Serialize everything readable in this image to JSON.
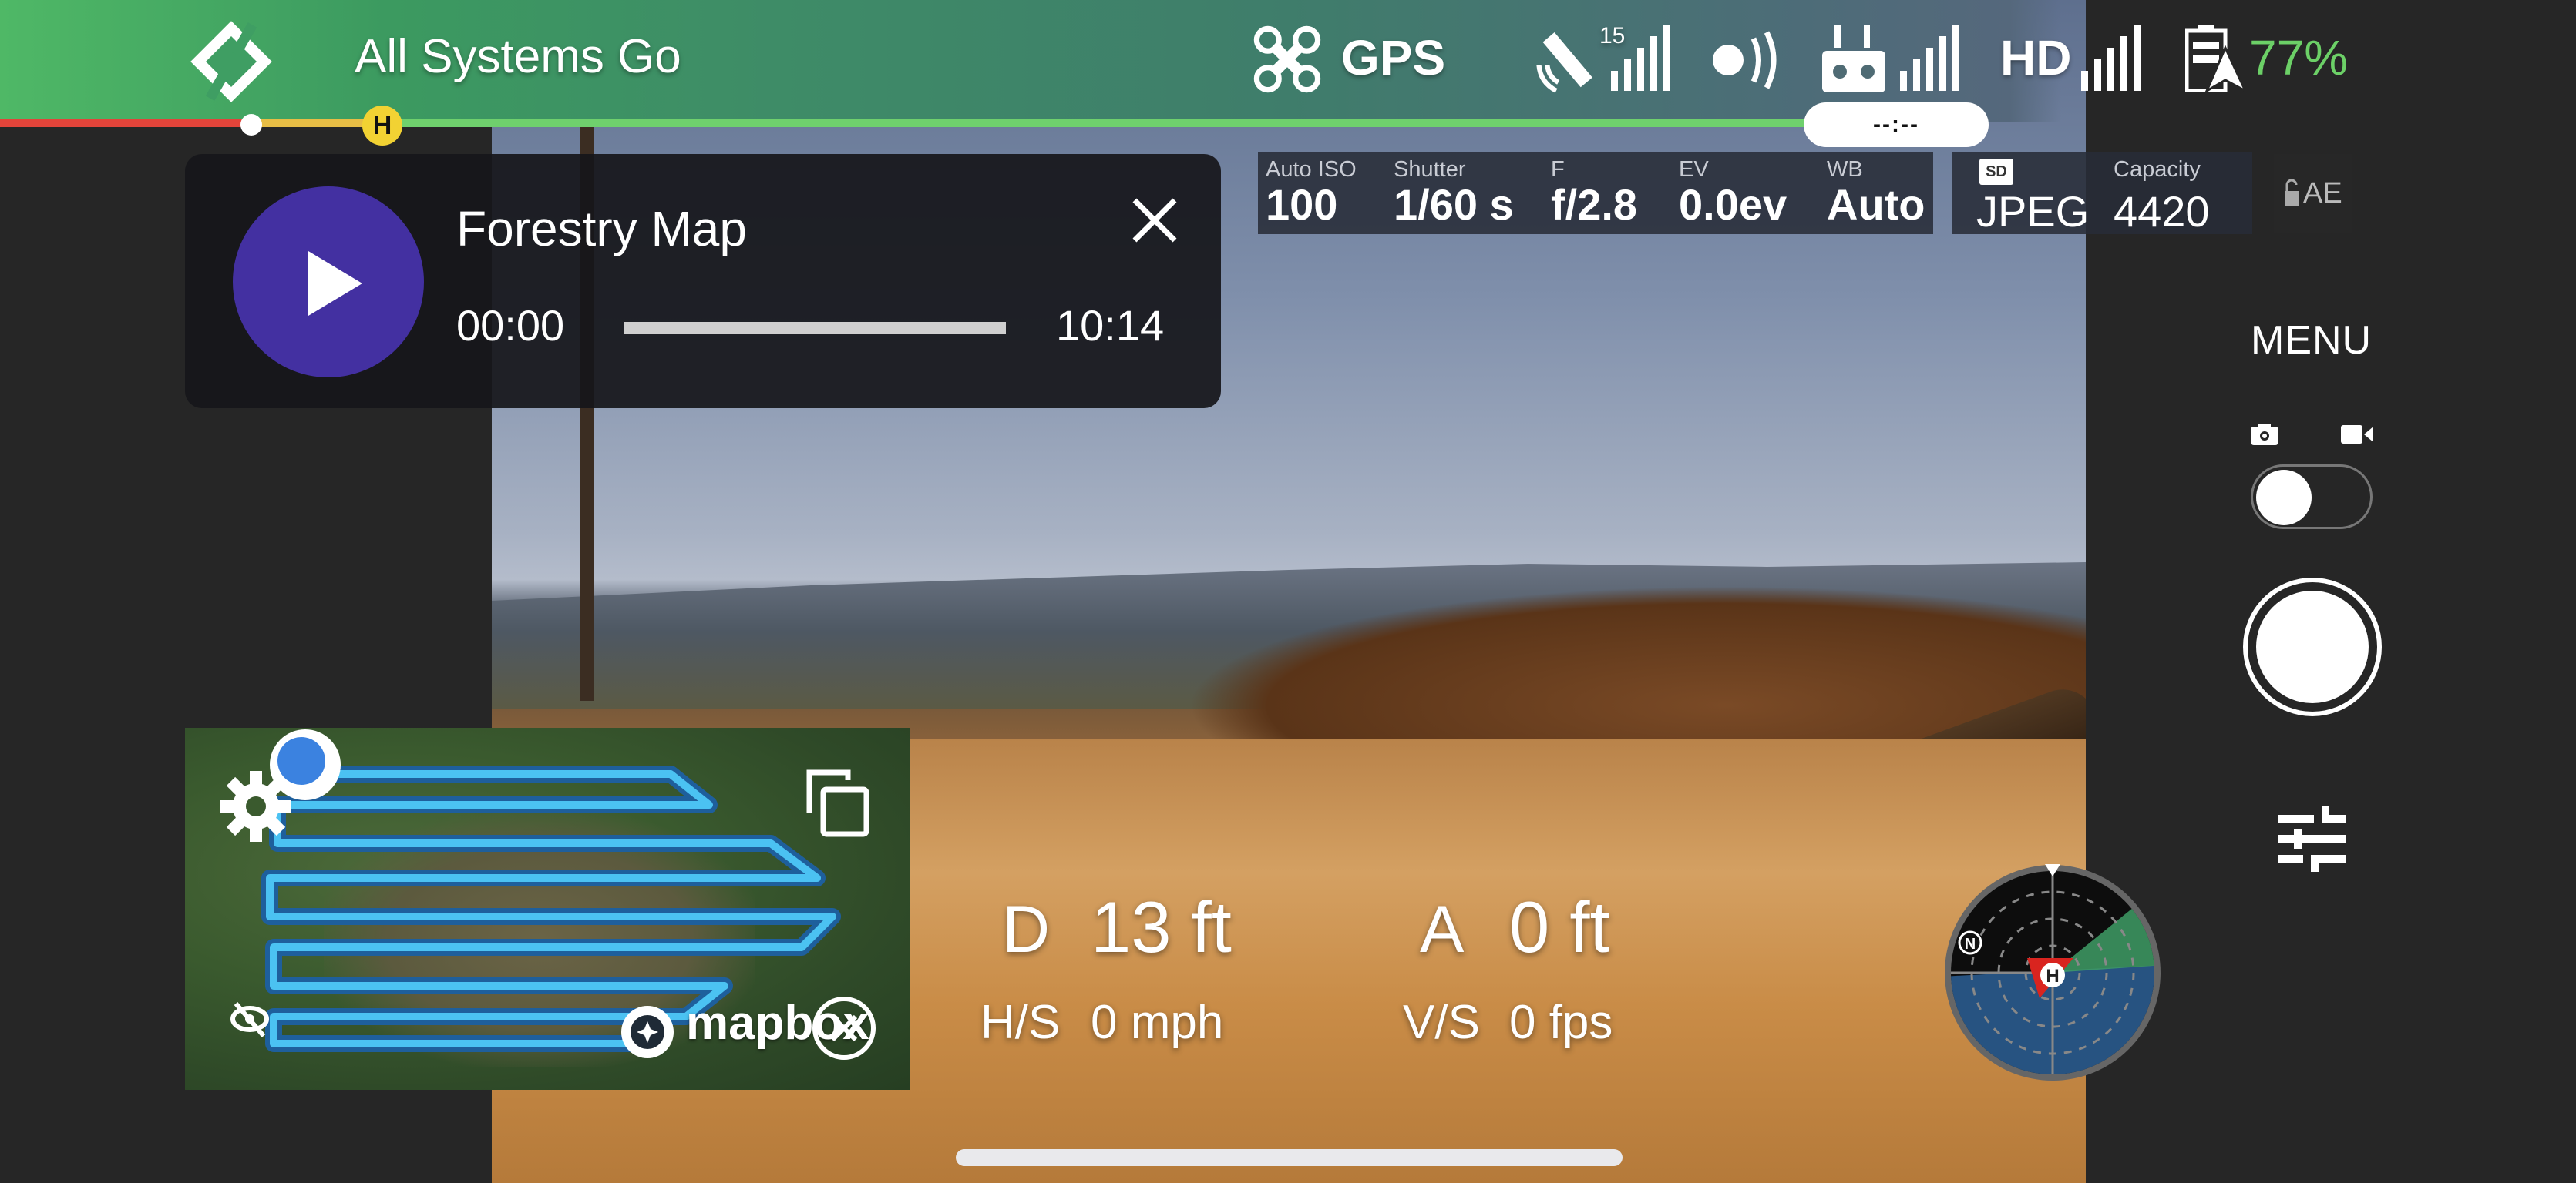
{
  "status": {
    "message": "All Systems Go",
    "flight_mode": "GPS",
    "satellite_count": "15",
    "video_quality": "HD",
    "battery_percent": "77%",
    "battery_color": "#6cd067",
    "flight_timer": "--:--",
    "home_marker": "H",
    "icons": {
      "logo": "app-logo-icon",
      "drone": "drone-icon",
      "satellite": "satellite-icon",
      "rc_signal": "signal-wave-icon",
      "controller": "remote-controller-icon",
      "battery": "battery-icon"
    },
    "progress_colors": {
      "critical": "#e2443a",
      "warning": "#e7bd45",
      "ok": "#6fd06d"
    }
  },
  "media_player": {
    "title": "Forestry Map",
    "current_time": "00:00",
    "total_time": "10:14",
    "progress": 0,
    "accent": "#4330a1"
  },
  "camera": {
    "params": [
      {
        "label": "Auto ISO",
        "value": "100"
      },
      {
        "label": "Shutter",
        "value": "1/60 s"
      },
      {
        "label": "F",
        "value": "f/2.8"
      },
      {
        "label": "EV",
        "value": "0.0ev"
      },
      {
        "label": "WB",
        "value": "Auto"
      }
    ],
    "format": {
      "storage_icon": "SD",
      "value": "JPEG"
    },
    "capacity": {
      "label": "Capacity",
      "value": "4420"
    },
    "ae_lock": "AE"
  },
  "right_panel": {
    "menu_label": "MENU",
    "mode": "photo",
    "modes": [
      "photo",
      "video"
    ]
  },
  "map": {
    "attribution": "mapbox"
  },
  "telemetry": {
    "distance": {
      "label": "D",
      "value": "13 ft"
    },
    "altitude": {
      "label": "A",
      "value": "0 ft"
    },
    "h_speed": {
      "label": "H/S",
      "value": "0 mph"
    },
    "v_speed": {
      "label": "V/S",
      "value": "0 fps"
    }
  },
  "radar": {
    "north_label": "N",
    "home_label": "H"
  }
}
